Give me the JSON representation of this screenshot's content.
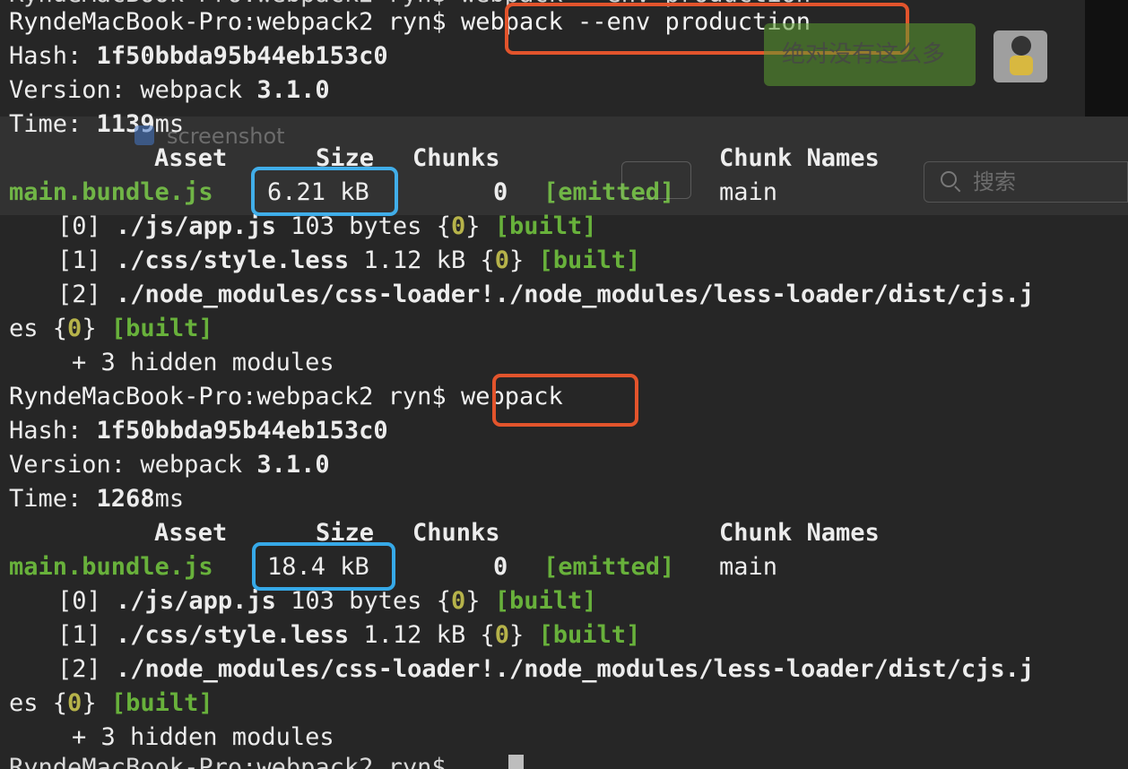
{
  "prompt": "RyndeMacBook-Pro:webpack2 ryn$",
  "ghost_top": "RyndeMacBook-Pro:webpack2 ryn$ webpack --env production",
  "run1": {
    "command": "webpack --env production",
    "hash_label": "Hash:",
    "hash_value": "1f50bbda95b44eb153c0",
    "version_label": "Version:",
    "version_name": "webpack",
    "version_number": "3.1.0",
    "time_label": "Time:",
    "time_value": "1139",
    "time_unit": "ms",
    "columns": {
      "asset": "Asset",
      "size": "Size",
      "chunks": "Chunks",
      "chunk_names": "Chunk Names"
    },
    "asset": {
      "name": "main.bundle.js",
      "size": "6.21 kB",
      "chunk": "0",
      "status": "[emitted]",
      "chunk_name": "main"
    },
    "modules": [
      {
        "id": "[0]",
        "path": "./js/app.js",
        "size": "103 bytes",
        "chunk_open": "{",
        "chunk": "0",
        "chunk_close": "}",
        "status": "[built]"
      },
      {
        "id": "[1]",
        "path": "./css/style.less",
        "size": "1.12 kB",
        "chunk_open": "{",
        "chunk": "0",
        "chunk_close": "}",
        "status": "[built]"
      },
      {
        "id": "[2]",
        "path": "./node_modules/css-loader!./node_modules/less-loader/dist/cjs.j"
      }
    ],
    "wrap": {
      "prefix": "es",
      "chunk_open": "{",
      "chunk": "0",
      "chunk_close": "}",
      "status": "[built]"
    },
    "hidden": "+ 3 hidden modules"
  },
  "run2": {
    "command": "webpack",
    "hash_label": "Hash:",
    "hash_value": "1f50bbda95b44eb153c0",
    "version_label": "Version:",
    "version_name": "webpack",
    "version_number": "3.1.0",
    "time_label": "Time:",
    "time_value": "1268",
    "time_unit": "ms",
    "columns": {
      "asset": "Asset",
      "size": "Size",
      "chunks": "Chunks",
      "chunk_names": "Chunk Names"
    },
    "asset": {
      "name": "main.bundle.js",
      "size": "18.4 kB",
      "chunk": "0",
      "status": "[emitted]",
      "chunk_name": "main"
    },
    "modules": [
      {
        "id": "[0]",
        "path": "./js/app.js",
        "size": "103 bytes",
        "chunk_open": "{",
        "chunk": "0",
        "chunk_close": "}",
        "status": "[built]"
      },
      {
        "id": "[1]",
        "path": "./css/style.less",
        "size": "1.12 kB",
        "chunk_open": "{",
        "chunk": "0",
        "chunk_close": "}",
        "status": "[built]"
      },
      {
        "id": "[2]",
        "path": "./node_modules/css-loader!./node_modules/less-loader/dist/cjs.j"
      }
    ],
    "wrap": {
      "prefix": "es",
      "chunk_open": "{",
      "chunk": "0",
      "chunk_close": "}",
      "status": "[built]"
    },
    "hidden": "+ 3 hidden modules"
  },
  "final_prompt": "RyndeMacBook-Pro:webpack2 ryn$",
  "overlay": {
    "chat_bubble": "绝对没有这么多",
    "checkbox_label": "screenshot",
    "search_placeholder": "搜索"
  },
  "colors": {
    "background": "#262626",
    "text": "#ececec",
    "green": "#68b13b",
    "yellow": "#b6b34a",
    "highlight_red": "#e2542c",
    "highlight_blue": "#36a9e8"
  },
  "icons": [
    "search-icon",
    "avatar",
    "checkbox"
  ]
}
